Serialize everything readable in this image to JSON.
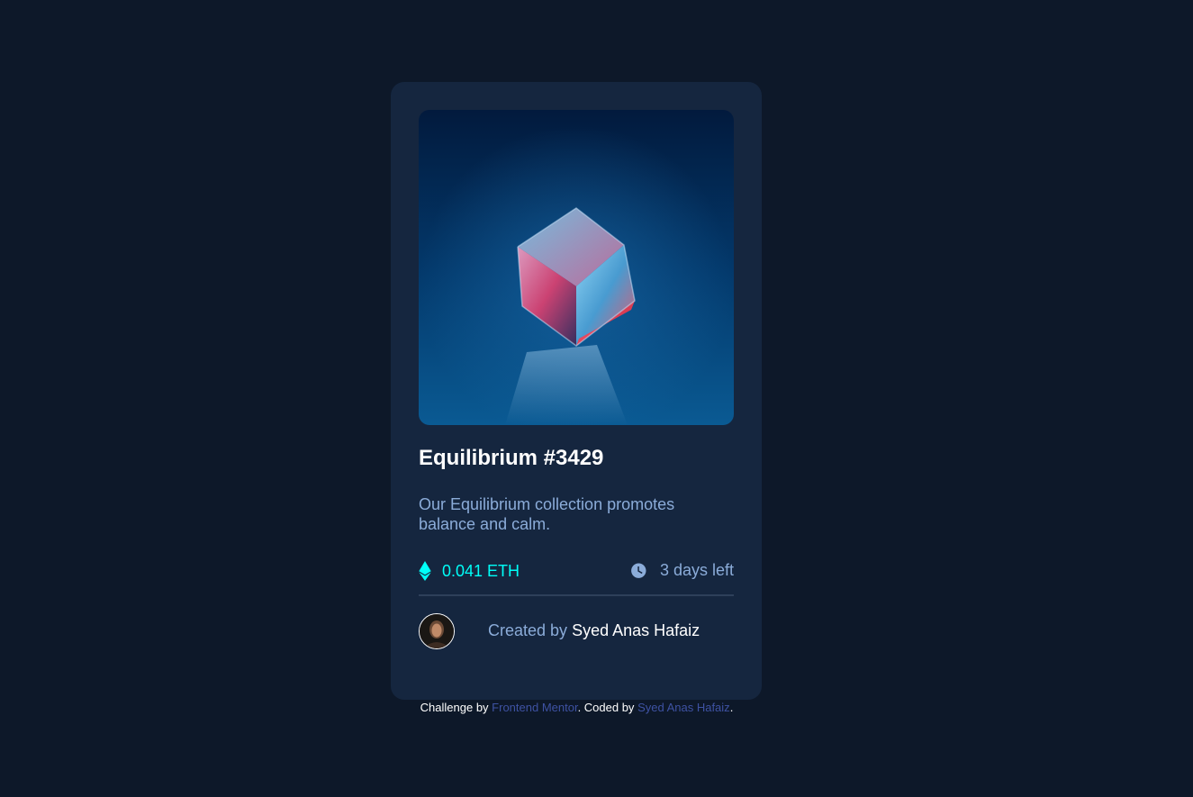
{
  "card": {
    "image": {
      "icon": "crystal-cube-image"
    },
    "title": "Equilibrium #3429",
    "description": "Our Equilibrium collection promotes balance and calm.",
    "price": {
      "icon": "ethereum-icon",
      "value": "0.041 ETH"
    },
    "time": {
      "icon": "clock-icon",
      "value": "3 days left"
    },
    "creator": {
      "avatar_icon": "avatar",
      "prefix": "Created by ",
      "name": "Syed Anas Hafaiz"
    }
  },
  "attribution": {
    "part1": "Challenge by ",
    "link1": "Frontend Mentor",
    "part2": ". Coded by ",
    "link2": "Syed Anas Hafaiz",
    "part3": "."
  },
  "colors": {
    "page_bg": "#0d1829",
    "card_bg": "#15263f",
    "cyan": "#00fff8",
    "soft_blue": "#8bacd9",
    "link": "#3e52a3"
  }
}
